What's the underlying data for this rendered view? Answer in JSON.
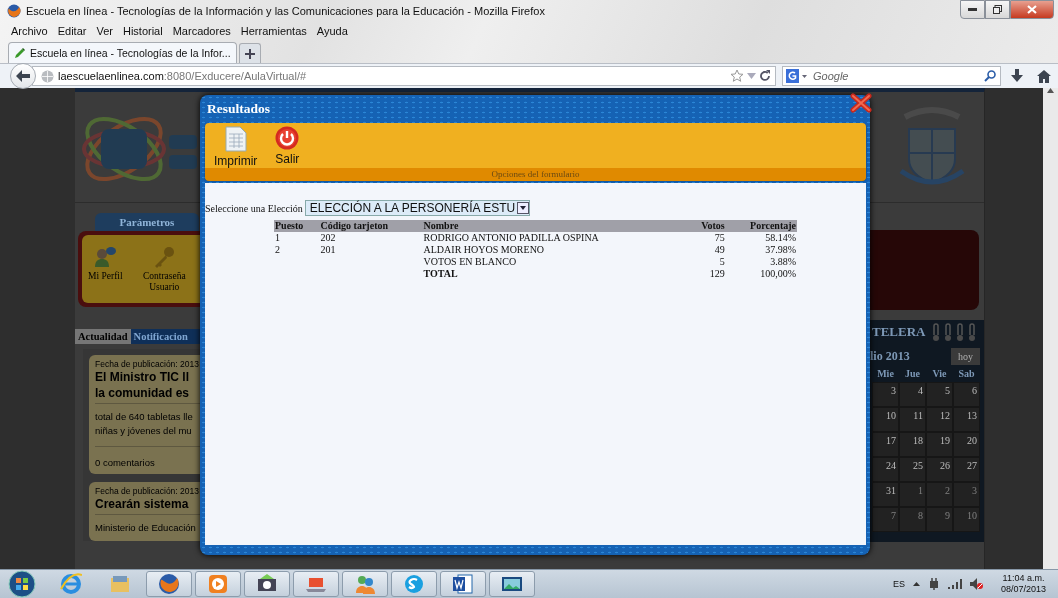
{
  "window": {
    "title": "Escuela en línea - Tecnologías de la Información y las Comunicaciones para la Educación - Mozilla Firefox"
  },
  "menu": [
    "Archivo",
    "Editar",
    "Ver",
    "Historial",
    "Marcadores",
    "Herramientas",
    "Ayuda"
  ],
  "tabs": [
    {
      "label": "Escuela en línea - Tecnologías de la Infor...",
      "selected": true
    }
  ],
  "address": {
    "host": "laescuelaenlinea.com",
    "path": ":8080/Exducere/AulaVirtual/#"
  },
  "search": {
    "placeholder": "Google"
  },
  "page": {
    "parameters_tab": "Parámetros",
    "shortcuts": [
      "Mi Perfil",
      "Contraseña Usuario"
    ],
    "news_tabs": [
      {
        "label": "Actualidad",
        "selected": true
      },
      {
        "label": "Notificacion",
        "selected": false
      }
    ],
    "news": [
      {
        "date": "Fecha de publicación: 2013",
        "title_lines": [
          "El Ministro TIC ll",
          "la comunidad es"
        ],
        "summary_lines": [
          "total de 640 tabletas lle",
          "niñas y jóvenes del mu"
        ],
        "comments": "0 comentarios"
      },
      {
        "date": "Fecha de publicación: 2013",
        "title_lines": [
          "Crearán sistema"
        ],
        "summary_lines": [
          "Ministerio de Educación"
        ]
      }
    ],
    "calendar": {
      "title": "TELERA",
      "month": "lio 2013",
      "today_button": "hoy",
      "weekdays": [
        "Mie",
        "Jue",
        "Vie",
        "Sab"
      ],
      "days": [
        {
          "day": "3",
          "other_month": false
        },
        {
          "day": "4",
          "other_month": false
        },
        {
          "day": "5",
          "other_month": false
        },
        {
          "day": "6",
          "other_month": false
        },
        {
          "day": "10",
          "other_month": false
        },
        {
          "day": "11",
          "other_month": false
        },
        {
          "day": "12",
          "other_month": false
        },
        {
          "day": "13",
          "other_month": false
        },
        {
          "day": "17",
          "other_month": false
        },
        {
          "day": "18",
          "other_month": false
        },
        {
          "day": "19",
          "other_month": false
        },
        {
          "day": "20",
          "other_month": false
        },
        {
          "day": "24",
          "other_month": false
        },
        {
          "day": "25",
          "other_month": false
        },
        {
          "day": "26",
          "other_month": false
        },
        {
          "day": "27",
          "other_month": false
        },
        {
          "day": "31",
          "other_month": false
        },
        {
          "day": "1",
          "other_month": true
        },
        {
          "day": "2",
          "other_month": true
        },
        {
          "day": "3",
          "other_month": true
        },
        {
          "day": "7",
          "other_month": true
        },
        {
          "day": "8",
          "other_month": true
        },
        {
          "day": "9",
          "other_month": true
        },
        {
          "day": "10",
          "other_month": true
        }
      ]
    }
  },
  "dialog": {
    "title": "Resultados",
    "toolbar": [
      {
        "kind": "print",
        "label": "Imprimir"
      },
      {
        "kind": "exit",
        "label": "Salir"
      }
    ],
    "toolbar_caption": "Opciones del formulario",
    "election_label": "Seleccione una Elección",
    "election_value": "ELECCIÓN A LA PERSONERÍA ESTU",
    "table": {
      "columns": [
        "Puesto",
        "Código tarjeton",
        "Nombre",
        "Votos",
        "Porcentaje"
      ],
      "rows": [
        {
          "kind": "candidate",
          "cells": [
            "1",
            "202",
            "RODRIGO ANTONIO PADILLA OSPINA",
            "75",
            "58.14%"
          ]
        },
        {
          "kind": "candidate",
          "cells": [
            "2",
            "201",
            "ALDAIR HOYOS MORENO",
            "49",
            "37.98%"
          ]
        },
        {
          "kind": "candidate",
          "cells": [
            "",
            "",
            "VOTOS EN BLANCO",
            "5",
            "3.88%"
          ]
        },
        {
          "kind": "total",
          "cells": [
            "",
            "",
            "TOTAL",
            "129",
            "100,00%"
          ]
        }
      ]
    }
  },
  "taskbar": {
    "language": "ES",
    "time": "11:04 a.m.",
    "date": "08/07/2013"
  }
}
